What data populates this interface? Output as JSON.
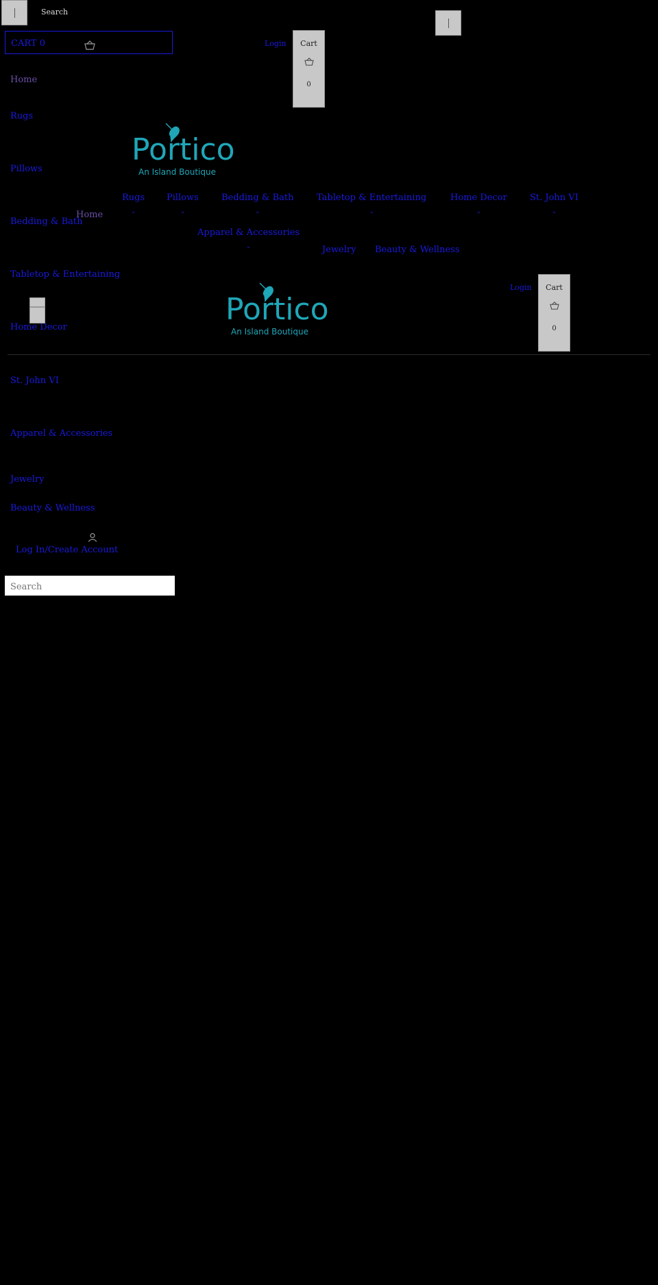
{
  "topbar": {
    "search_label": "Search"
  },
  "cart_bar": {
    "label": "CART 0"
  },
  "header": {
    "login": "Login",
    "cart_label": "Cart",
    "cart_count": "0"
  },
  "side_nav": [
    {
      "label": "Home"
    },
    {
      "label": "Rugs"
    },
    {
      "label": "Pillows"
    },
    {
      "label": "Bedding & Bath"
    },
    {
      "label": "Tabletop & Entertaining"
    },
    {
      "label": "Home Decor"
    },
    {
      "label": "St. John VI"
    },
    {
      "label": "Apparel & Accessories"
    },
    {
      "label": "Jewelry"
    },
    {
      "label": "Beauty & Wellness"
    }
  ],
  "side_account": {
    "label": "Log In/Create Account"
  },
  "side_search": {
    "placeholder": "Search"
  },
  "logo": {
    "title": "Portico",
    "subtitle": "An Island Boutique"
  },
  "main_nav": [
    {
      "label": "Home"
    },
    {
      "label": "Rugs"
    },
    {
      "label": "Pillows"
    },
    {
      "label": "Bedding & Bath"
    },
    {
      "label": "Tabletop & Entertaining"
    },
    {
      "label": "Home Decor"
    },
    {
      "label": "St. John VI"
    },
    {
      "label": "Apparel & Accessories"
    },
    {
      "label": "Jewelry"
    },
    {
      "label": "Beauty & Wellness"
    }
  ],
  "colors": {
    "background": "#000000",
    "link": "#1a1adf",
    "visited": "#6b4fa8",
    "logo": "#1fa7b8",
    "button": "#c8c8c8"
  }
}
